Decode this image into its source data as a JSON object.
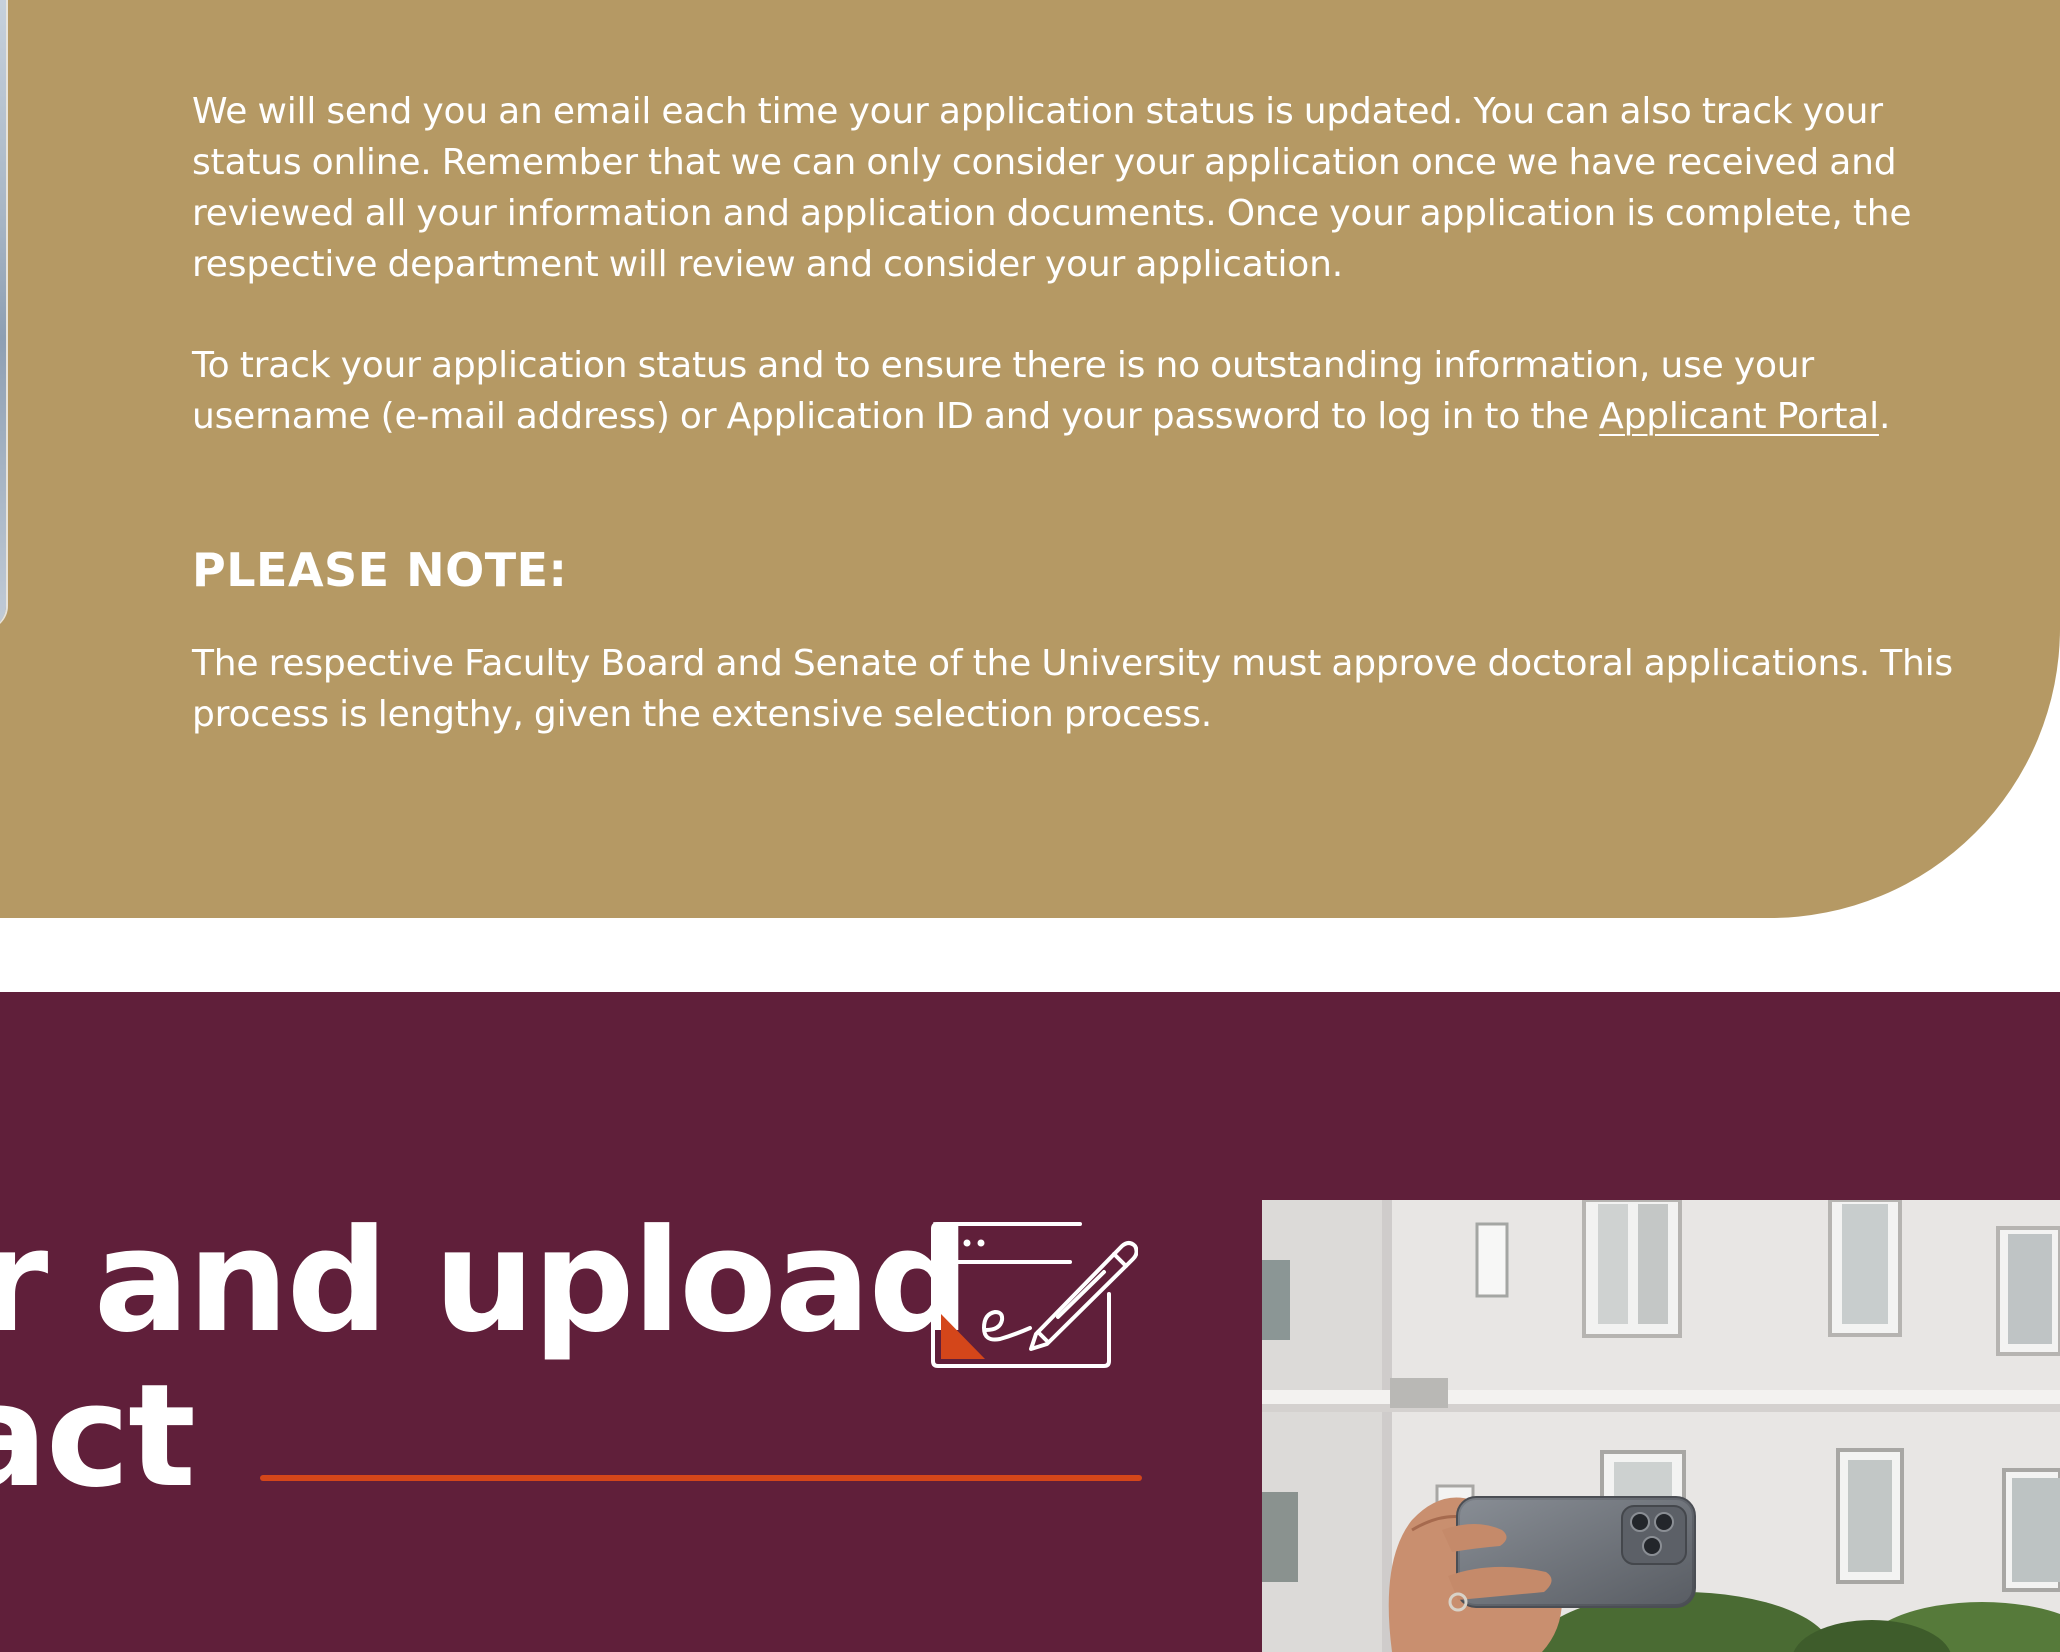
{
  "colors": {
    "gold_panel": "#b59964",
    "maroon_section": "#601f3a",
    "accent": "#d4461a",
    "text_on_dark": "#ffffff"
  },
  "status_info": {
    "paragraph_1": "We will send you an email each time your application status is updated. You can also track your status online. Remember that we can only consider your application once we have received and reviewed all your information and application documents. Once your application is complete, the respective department will review and consider your application.",
    "paragraph_2_before_link": "To track your application status and to ensure there is no outstanding information, use your username (e-mail address) or Application ID and your password to log in to the ",
    "portal_link_label": "Applicant Portal",
    "paragraph_2_after_link": "."
  },
  "note": {
    "heading": "PLEASE NOTE:",
    "text": "The respective Faculty Board and Senate of the University must approve doctoral applications. This process is lengthy, given the extensive selection process."
  },
  "contract_section": {
    "title_line_1": "er and upload",
    "title_line_2": "ract",
    "icon": "e-signature-document-icon"
  },
  "photo": {
    "subject": "hand-holding-smartphone-photo"
  }
}
